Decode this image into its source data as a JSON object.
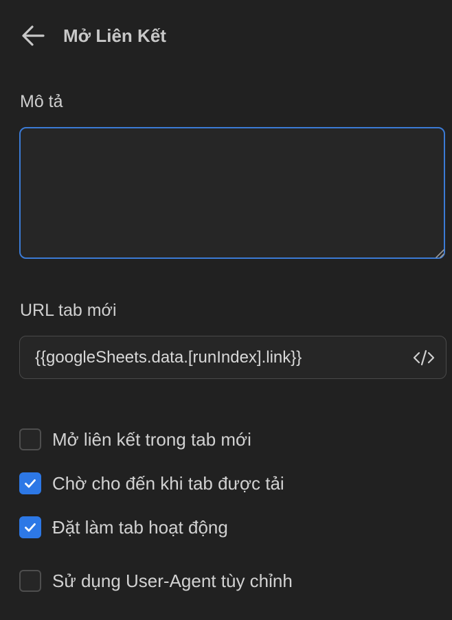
{
  "header": {
    "title": "Mở Liên Kết",
    "back_icon": "arrow-left-icon"
  },
  "description": {
    "label": "Mô tả",
    "value": "",
    "placeholder": ""
  },
  "url": {
    "label": "URL tab mới",
    "value": "{{googleSheets.data.[runIndex].link}}",
    "code_icon": "code-icon"
  },
  "options": [
    {
      "label": "Mở liên kết trong tab mới",
      "checked": false
    },
    {
      "label": "Chờ cho đến khi tab được tải",
      "checked": true
    },
    {
      "label": "Đặt làm tab hoạt động",
      "checked": true
    },
    {
      "label": "Sử dụng User-Agent tùy chỉnh",
      "checked": false
    }
  ],
  "colors": {
    "background": "#212121",
    "accent": "#2d78e6",
    "focus_border": "#3b7bd6",
    "text": "#d2d2d2"
  }
}
